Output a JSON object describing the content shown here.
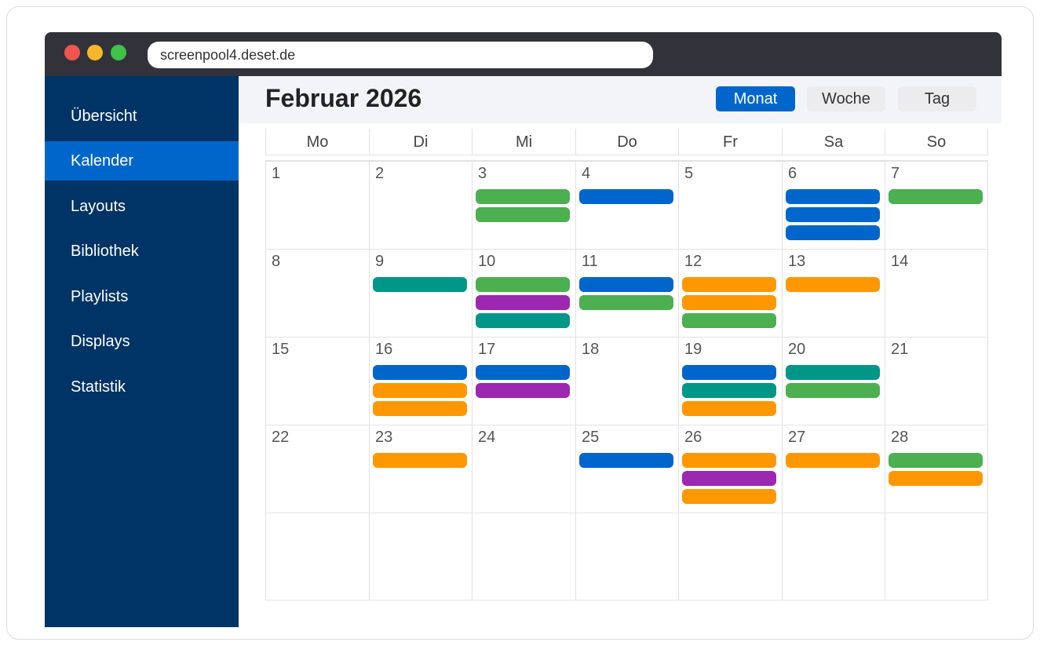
{
  "browser": {
    "url": "screenpool4.deset.de"
  },
  "sidebar": {
    "items": [
      {
        "label": "Übersicht",
        "active": false
      },
      {
        "label": "Kalender",
        "active": true
      },
      {
        "label": "Layouts",
        "active": false
      },
      {
        "label": "Bibliothek",
        "active": false
      },
      {
        "label": "Playlists",
        "active": false
      },
      {
        "label": "Displays",
        "active": false
      },
      {
        "label": "Statistik",
        "active": false
      }
    ]
  },
  "header": {
    "title": "Februar 2026",
    "views": [
      {
        "label": "Monat",
        "active": true
      },
      {
        "label": "Woche",
        "active": false
      },
      {
        "label": "Tag",
        "active": false
      }
    ]
  },
  "calendar": {
    "weekdays": [
      "Mo",
      "Di",
      "Mi",
      "Do",
      "Fr",
      "Sa",
      "So"
    ],
    "weeks": [
      [
        {
          "day": "1",
          "events": []
        },
        {
          "day": "2",
          "events": []
        },
        {
          "day": "3",
          "events": [
            "green",
            "green"
          ]
        },
        {
          "day": "4",
          "events": [
            "blue"
          ]
        },
        {
          "day": "5",
          "events": []
        },
        {
          "day": "6",
          "events": [
            "blue",
            "blue",
            "blue"
          ]
        },
        {
          "day": "7",
          "events": [
            "green"
          ]
        }
      ],
      [
        {
          "day": "8",
          "events": []
        },
        {
          "day": "9",
          "events": [
            "teal"
          ]
        },
        {
          "day": "10",
          "events": [
            "green",
            "purple",
            "teal"
          ]
        },
        {
          "day": "11",
          "events": [
            "blue",
            "green"
          ]
        },
        {
          "day": "12",
          "events": [
            "orange",
            "orange",
            "green"
          ]
        },
        {
          "day": "13",
          "events": [
            "orange"
          ]
        },
        {
          "day": "14",
          "events": []
        }
      ],
      [
        {
          "day": "15",
          "events": []
        },
        {
          "day": "16",
          "events": [
            "blue",
            "orange",
            "orange"
          ]
        },
        {
          "day": "17",
          "events": [
            "blue",
            "purple"
          ]
        },
        {
          "day": "18",
          "events": []
        },
        {
          "day": "19",
          "events": [
            "blue",
            "teal",
            "orange"
          ]
        },
        {
          "day": "20",
          "events": [
            "teal",
            "green"
          ]
        },
        {
          "day": "21",
          "events": []
        }
      ],
      [
        {
          "day": "22",
          "events": []
        },
        {
          "day": "23",
          "events": [
            "orange"
          ]
        },
        {
          "day": "24",
          "events": []
        },
        {
          "day": "25",
          "events": [
            "blue"
          ]
        },
        {
          "day": "26",
          "events": [
            "orange",
            "purple",
            "orange"
          ]
        },
        {
          "day": "27",
          "events": [
            "orange"
          ]
        },
        {
          "day": "28",
          "events": [
            "green",
            "orange"
          ]
        }
      ],
      [
        {
          "day": "",
          "events": []
        },
        {
          "day": "",
          "events": []
        },
        {
          "day": "",
          "events": []
        },
        {
          "day": "",
          "events": []
        },
        {
          "day": "",
          "events": []
        },
        {
          "day": "",
          "events": []
        },
        {
          "day": "",
          "events": []
        }
      ]
    ]
  },
  "colors": {
    "blue": "#0066cc",
    "green": "#4caf50",
    "orange": "#ff9800",
    "purple": "#9c27b0",
    "teal": "#009688",
    "sidebar": "#003366",
    "accent": "#0066cc"
  }
}
